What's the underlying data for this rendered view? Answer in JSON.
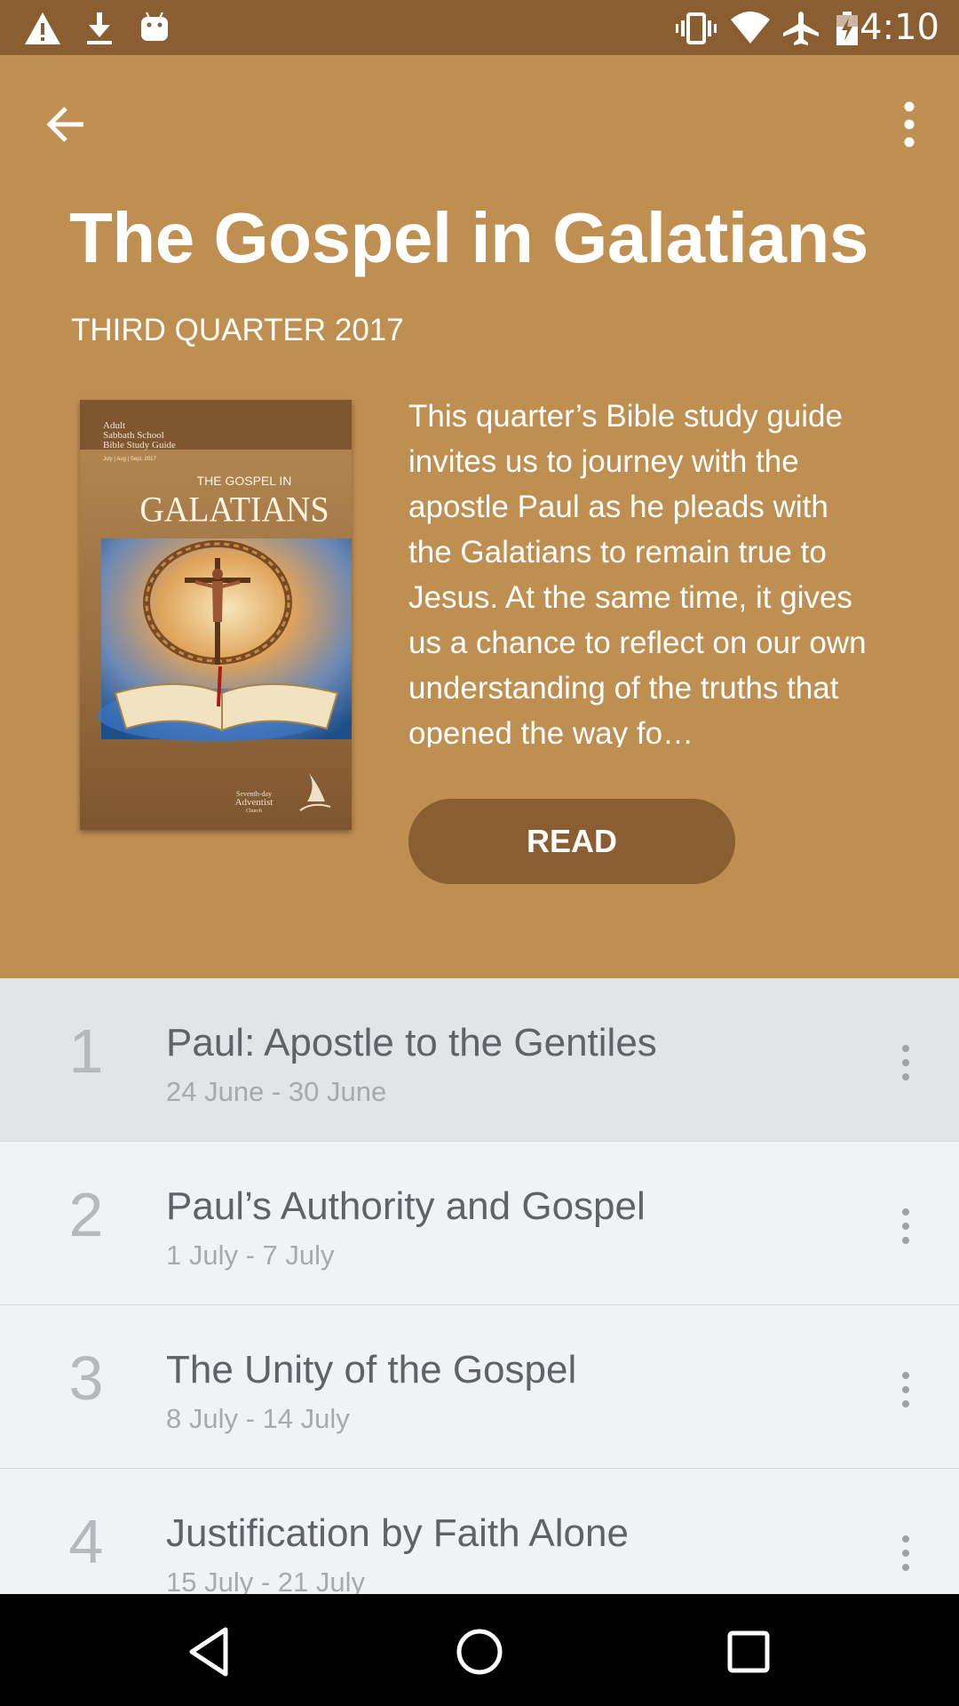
{
  "status_bar": {
    "time": "4:10",
    "left_icons": [
      "warning-icon",
      "download-icon",
      "android-icon"
    ],
    "right_icons": [
      "vibrate-icon",
      "wifi-icon",
      "airplane-mode-icon",
      "battery-icon"
    ]
  },
  "toolbar": {
    "back_icon": "arrow-back-icon",
    "menu_icon": "more-vert-icon"
  },
  "quarterly": {
    "title": "The Gospel in Galatians",
    "subtitle": "THIRD QUARTER 2017",
    "description": "This quarter’s Bible study guide invites us to journey with the apostle Paul as he pleads with the Galatians to remain true to Jesus. At the same time, it gives us a chance to reflect on our own understanding of the truths that opened the way fo…",
    "read_label": "READ",
    "cover": {
      "line1": "Adult",
      "line2": "Sabbath School",
      "line3": "Bible Study Guide",
      "line4": "July | Aug | Sept. 2017",
      "small_title": "THE GOSPEL IN",
      "big_title": "GALATIANS",
      "logo_line1": "Seventh-day",
      "logo_line2": "Adventist",
      "logo_line3": "Church"
    }
  },
  "colors": {
    "header": "#bf8f52",
    "status_bar": "#8b5e32",
    "read_button": "#8b5e32",
    "list_bg": "#f0f3f6",
    "active_row": "#e2e4e7"
  },
  "lessons": [
    {
      "number": "1",
      "title": "Paul: Apostle to the Gentiles",
      "dates": "24 June - 30 June"
    },
    {
      "number": "2",
      "title": "Paul’s Authority and Gospel",
      "dates": "1 July - 7 July"
    },
    {
      "number": "3",
      "title": "The Unity of the Gospel",
      "dates": "8 July - 14 July"
    },
    {
      "number": "4",
      "title": "Justification by Faith Alone",
      "dates": "15 July - 21 July"
    }
  ],
  "nav_bar": {
    "icons": [
      "back-triangle-icon",
      "home-circle-icon",
      "recents-square-icon"
    ]
  }
}
